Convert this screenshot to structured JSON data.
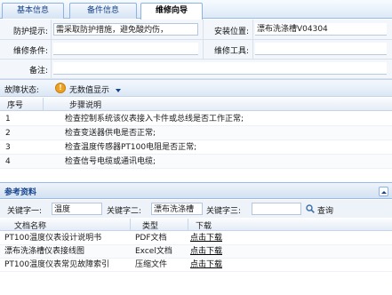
{
  "tabs": [
    {
      "label": "基本信息"
    },
    {
      "label": "备件信息"
    },
    {
      "label": "维修向导"
    }
  ],
  "form": {
    "protection_label": "防护提示:",
    "protection_value": "需采取防护措施，避免酸灼伤，",
    "location_label": "安装位置:",
    "location_value": "漂布洗涤槽V04304",
    "condition_label": "维修条件:",
    "condition_value": "",
    "tools_label": "维修工具:",
    "tools_value": "",
    "notes_label": "备注:",
    "notes_value": ""
  },
  "fault": {
    "label": "故障状态:",
    "value": "无数值显示",
    "icon": "warning-icon",
    "accent": "#f0a020"
  },
  "steps": {
    "col_index": "序号",
    "col_desc": "步骤说明",
    "rows": [
      {
        "no": "1",
        "desc": "检查控制系统该仪表接入卡件或总线是否工作正常;"
      },
      {
        "no": "2",
        "desc": "检查变送器供电是否正常;"
      },
      {
        "no": "3",
        "desc": "检查温度传感器PT100电阻是否正常;"
      },
      {
        "no": "4",
        "desc": "检查信号电缆或通讯电缆;"
      }
    ]
  },
  "refs": {
    "title": "参考资料",
    "kw1_label": "关键字一:",
    "kw1_value": "温度",
    "kw2_label": "关键字二:",
    "kw2_value": "漂布洗涤槽",
    "kw3_label": "关键字三:",
    "kw3_value": "",
    "query_label": "查询",
    "col_name": "文档名称",
    "col_type": "类型",
    "col_download": "下载",
    "rows": [
      {
        "name": "PT100温度仪表设计说明书",
        "type": "PDF文档",
        "download": "点击下载"
      },
      {
        "name": "漂布洗涤槽仪表接线图",
        "type": "Excel文档",
        "download": "点击下载"
      },
      {
        "name": "PT100温度仪表常见故障索引",
        "type": "压缩文件",
        "download": "点击下载"
      }
    ]
  }
}
